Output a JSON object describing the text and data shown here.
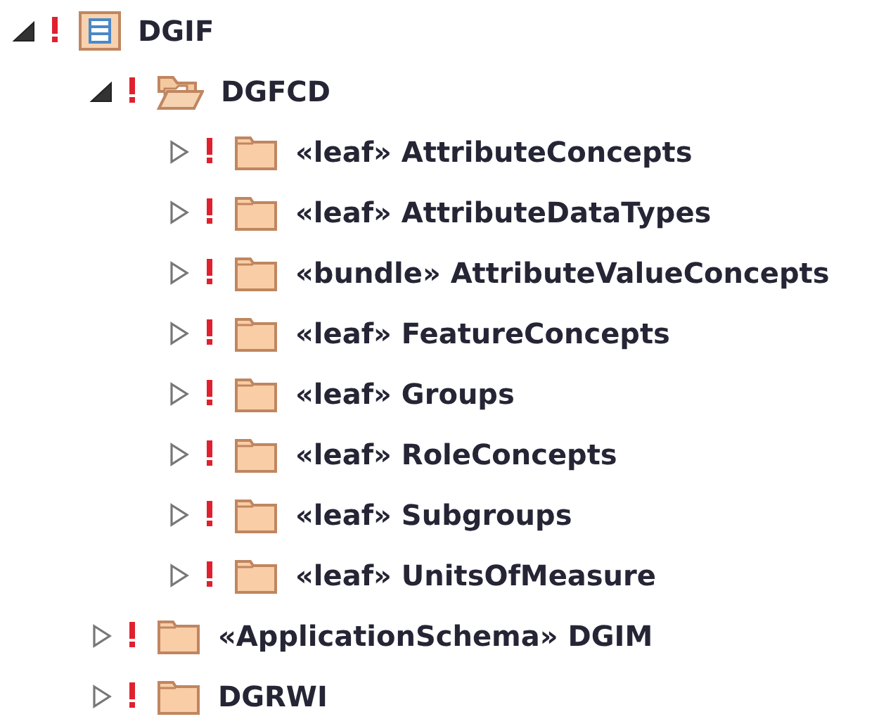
{
  "tree": [
    {
      "label": "DGIF",
      "kind": "model",
      "expanded": true,
      "warning": true,
      "children": [
        {
          "label": "DGFCD",
          "kind": "open-folder",
          "expanded": true,
          "warning": true,
          "children": [
            {
              "label": "«leaf» AttributeConcepts",
              "kind": "folder",
              "expanded": false,
              "warning": true
            },
            {
              "label": "«leaf» AttributeDataTypes",
              "kind": "folder",
              "expanded": false,
              "warning": true
            },
            {
              "label": "«bundle» AttributeValueConcepts",
              "kind": "folder",
              "expanded": false,
              "warning": true
            },
            {
              "label": "«leaf» FeatureConcepts",
              "kind": "folder",
              "expanded": false,
              "warning": true
            },
            {
              "label": "«leaf» Groups",
              "kind": "folder",
              "expanded": false,
              "warning": true
            },
            {
              "label": "«leaf» RoleConcepts",
              "kind": "folder",
              "expanded": false,
              "warning": true
            },
            {
              "label": "«leaf» Subgroups",
              "kind": "folder",
              "expanded": false,
              "warning": true
            },
            {
              "label": "«leaf» UnitsOfMeasure",
              "kind": "folder",
              "expanded": false,
              "warning": true
            }
          ]
        },
        {
          "label": "«ApplicationSchema» DGIM",
          "kind": "folder",
          "expanded": false,
          "warning": true
        },
        {
          "label": "DGRWI",
          "kind": "folder",
          "expanded": false,
          "warning": true
        }
      ]
    }
  ]
}
